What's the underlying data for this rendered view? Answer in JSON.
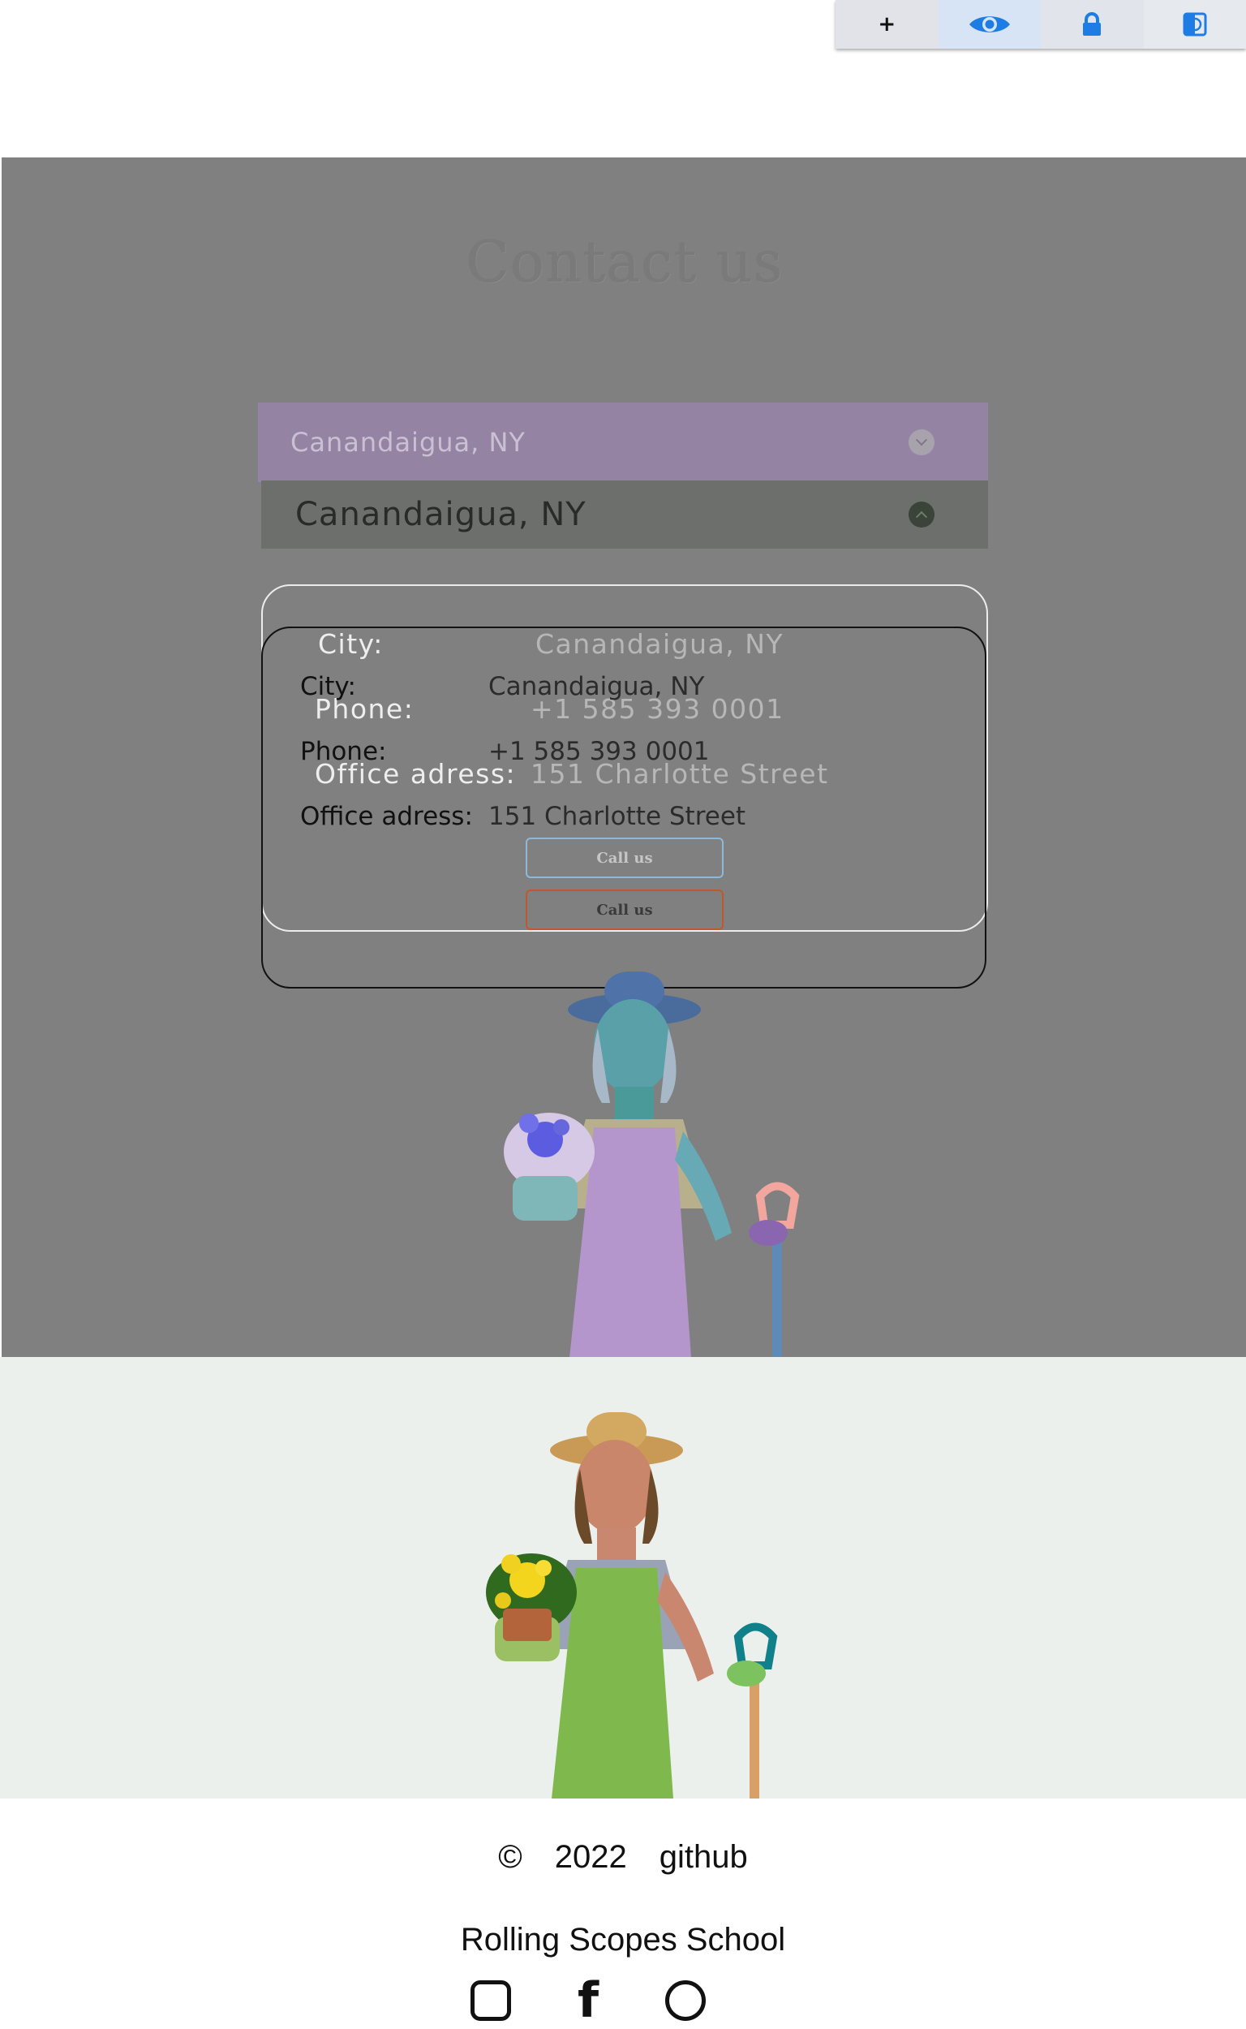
{
  "toolbar": {
    "add_label": "+",
    "buttons": [
      "add-icon",
      "eye-icon",
      "lock-icon",
      "split-view-icon"
    ],
    "accent": "#1d7de4"
  },
  "overlay": {
    "title": "Contact us",
    "accordion_open": {
      "city": "Canandaigua, NY"
    },
    "accordion_closed": {
      "city": "Canandaigua, NY"
    },
    "card_light": {
      "rows": [
        {
          "key": "City:",
          "value": "Canandaigua, NY"
        },
        {
          "key": "Phone:",
          "value": "+1 585 393 0001"
        },
        {
          "key": "Office adress:",
          "value": "151 Charlotte Street"
        }
      ],
      "button": "Call us"
    },
    "card_dark": {
      "rows": [
        {
          "key": "City:",
          "value": "Canandaigua, NY"
        },
        {
          "key": "Phone:",
          "value": "+1 585 393 0001"
        },
        {
          "key": "Office adress:",
          "value": "151 Charlotte Street"
        }
      ],
      "button": "Call us"
    }
  },
  "footer": {
    "copyright_symbol": "©",
    "year": "2022",
    "github": "github",
    "school": "Rolling Scopes School",
    "socials": [
      "instagram-icon",
      "facebook-icon",
      "pinterest-icon"
    ]
  },
  "colors": {
    "overlay_bg": "#808080",
    "accordion_open": "#9583a4",
    "accordion_closed": "#6c6f6b",
    "section_bg": "#ecf0ec"
  }
}
